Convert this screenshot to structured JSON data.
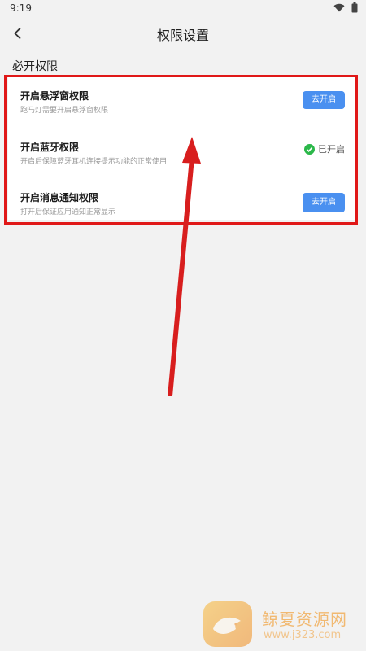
{
  "status_bar": {
    "time": "9:19"
  },
  "header": {
    "title": "权限设置"
  },
  "section": {
    "title": "必开权限"
  },
  "permissions": [
    {
      "title": "开启悬浮窗权限",
      "desc": "跑马灯需要开启悬浮窗权限",
      "action": "去开启"
    },
    {
      "title": "开启蓝牙权限",
      "desc": "开启后保障蓝牙耳机连接提示功能的正常使用",
      "status": "已开启"
    },
    {
      "title": "开启消息通知权限",
      "desc": "打开后保证应用通知正常显示",
      "action": "去开启"
    }
  ],
  "watermark": {
    "text": "鲸夏资源网",
    "url": "www.j323.com"
  },
  "colors": {
    "accent": "#4a90f0",
    "highlight": "#e01818",
    "enabled": "#2bb84a"
  }
}
